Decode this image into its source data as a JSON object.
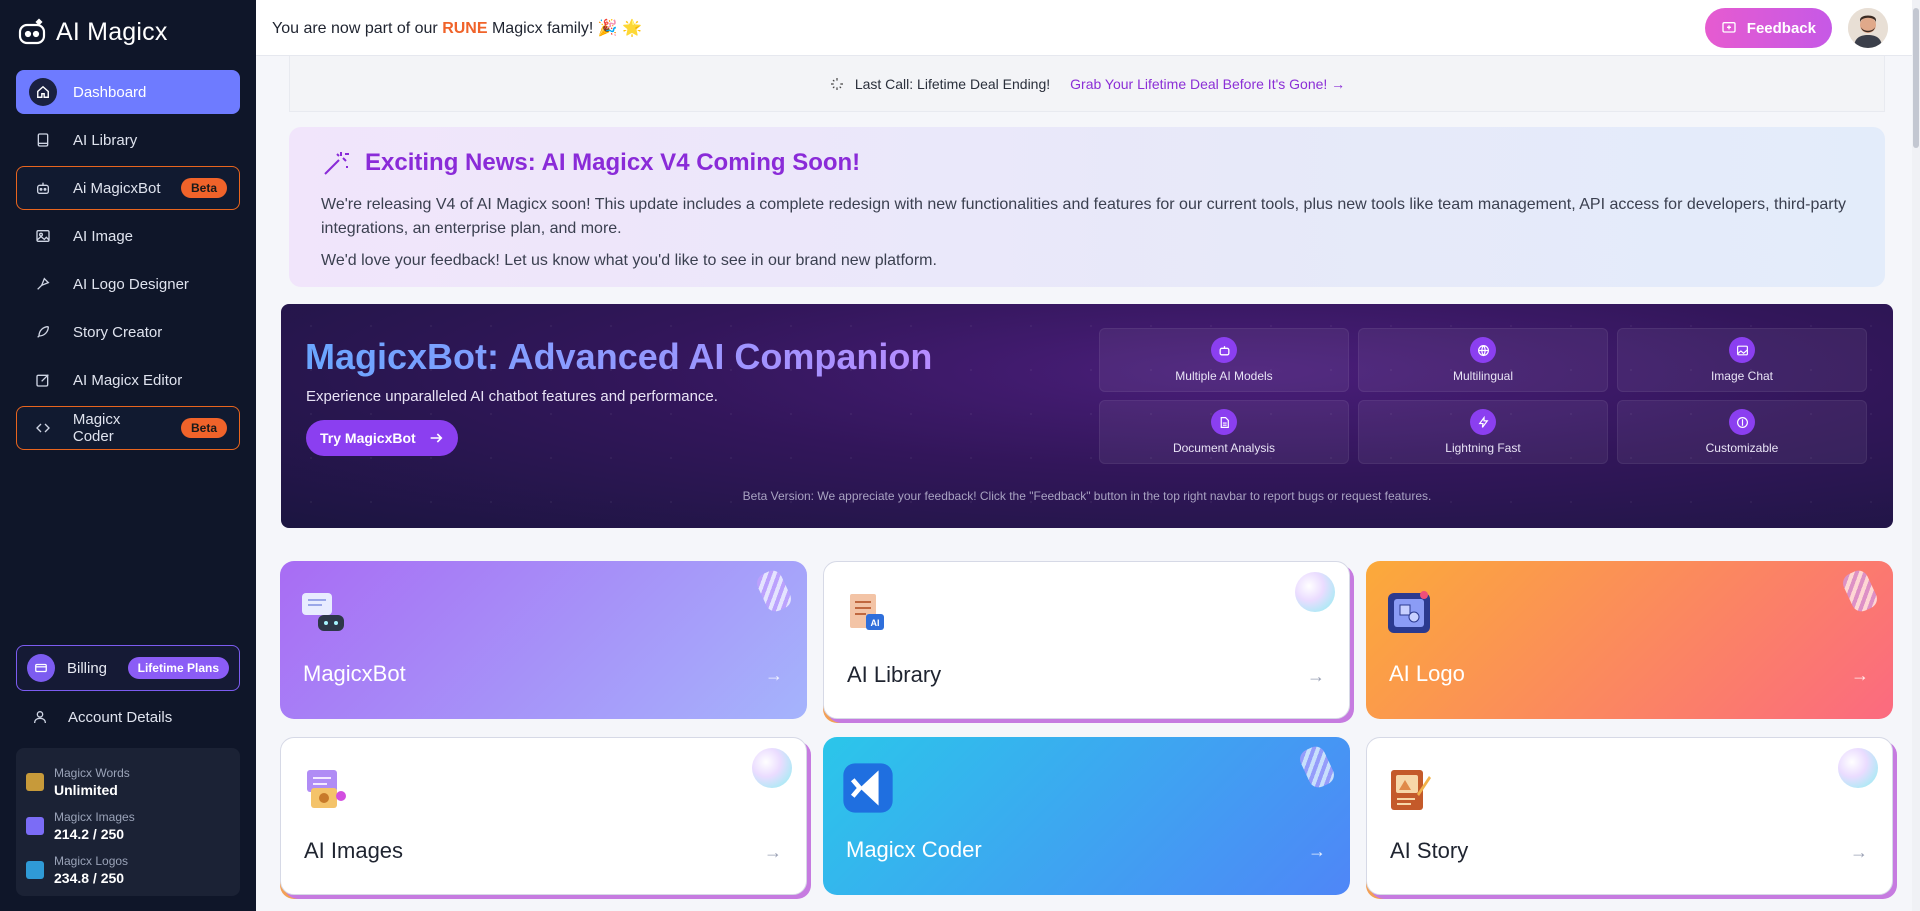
{
  "brand": {
    "name": "AI Magicx"
  },
  "sidebar": {
    "items": [
      {
        "label": "Dashboard",
        "icon": "home-icon"
      },
      {
        "label": "AI Library",
        "icon": "book-icon"
      },
      {
        "label": "Ai MagicxBot",
        "icon": "robot-icon",
        "badge": "Beta"
      },
      {
        "label": "AI Image",
        "icon": "image-icon"
      },
      {
        "label": "AI Logo Designer",
        "icon": "pen-tool-icon"
      },
      {
        "label": "Story Creator",
        "icon": "feather-icon"
      },
      {
        "label": "AI Magicx Editor",
        "icon": "edit-icon"
      },
      {
        "label": "Magicx Coder",
        "icon": "code-icon",
        "badge": "Beta"
      }
    ],
    "billing": {
      "label": "Billing",
      "badge": "Lifetime Plans"
    },
    "account": {
      "label": "Account Details"
    },
    "usage": [
      {
        "label": "Magicx Words",
        "value": "Unlimited",
        "color": "#c79a3a"
      },
      {
        "label": "Magicx Images",
        "value": "214.2 / 250",
        "color": "#7b6cf6"
      },
      {
        "label": "Magicx Logos",
        "value": "234.8 / 250",
        "color": "#2f9ad6"
      }
    ]
  },
  "topbar": {
    "announce_before": "You are now part of our ",
    "announce_rune": "RUNE",
    "announce_after": " Magicx family! 🎉 🌟",
    "feedback": "Feedback"
  },
  "deal": {
    "text": "Last Call: Lifetime Deal Ending!",
    "link": "Grab Your Lifetime Deal Before It's Gone! →"
  },
  "news": {
    "title": "Exciting News: AI Magicx V4 Coming Soon!",
    "p1": "We're releasing V4 of AI Magicx soon! This update includes a complete redesign with new functionalities and features for our current tools, plus new tools like team management, API access for developers, third-party integrations, an enterprise plan, and more.",
    "p2": "We'd love your feedback! Let us know what you'd like to see in our brand new platform."
  },
  "hero": {
    "title": "MagicxBot: Advanced AI Companion",
    "subtitle": "Experience unparalleled AI chatbot features and performance.",
    "button": "Try MagicxBot",
    "features": [
      {
        "label": "Multiple AI Models",
        "icon": "robot-icon"
      },
      {
        "label": "Multilingual",
        "icon": "globe-icon"
      },
      {
        "label": "Image Chat",
        "icon": "image-icon"
      },
      {
        "label": "Document Analysis",
        "icon": "document-icon"
      },
      {
        "label": "Lightning Fast",
        "icon": "lightning-icon"
      },
      {
        "label": "Customizable",
        "icon": "customize-icon"
      }
    ],
    "note": "Beta Version: We appreciate your feedback! Click the \"Feedback\" button in the top right navbar to report bugs or request features."
  },
  "cards": [
    {
      "title": "MagicxBot",
      "style": "purple",
      "icon": "chatbot-icon",
      "deco": "spring"
    },
    {
      "title": "AI Library",
      "style": "light",
      "icon": "library-doc-icon",
      "deco": "bubble"
    },
    {
      "title": "AI Logo",
      "style": "orange",
      "icon": "logo-frame-icon",
      "deco": "spring"
    },
    {
      "title": "AI Images",
      "style": "light",
      "icon": "image-gen-icon",
      "deco": "bubble"
    },
    {
      "title": "Magicx Coder",
      "style": "blue",
      "icon": "vscode-icon",
      "deco": "spring"
    },
    {
      "title": "AI Story",
      "style": "light",
      "icon": "story-book-icon",
      "deco": "bubble"
    }
  ],
  "colors": {
    "accent": "#6e7bff",
    "beta": "#f0632a",
    "purple": "#8a2bd8"
  }
}
